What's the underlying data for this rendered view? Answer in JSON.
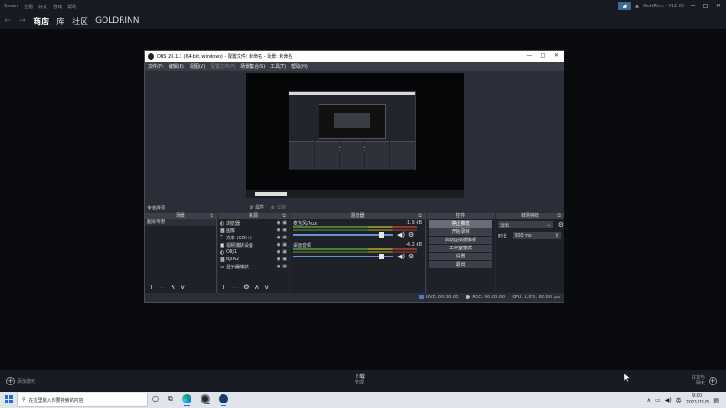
{
  "steam": {
    "menu": [
      "Steam",
      "查看",
      "好友",
      "游戏",
      "帮助"
    ],
    "nav": {
      "back": "←",
      "forward": "→",
      "store": "商店",
      "library": "库",
      "community": "社区",
      "username": "GOLDRINN"
    },
    "account": "GoldRinn · ¥12.00",
    "window_controls": {
      "minimize": "—",
      "maximize": "□",
      "close": "✕"
    },
    "bottom": {
      "add_game": "添加游戏",
      "downloads": "下载",
      "downloads_sub": "管理",
      "friends": "好友与",
      "chat": "聊天"
    }
  },
  "obs": {
    "title": "OBS 26.1.1 (64-bit, windows) - 配置文件: 未命名 - 场景: 未命名",
    "menu": [
      "文件(F)",
      "编辑(E)",
      "视图(V)",
      "配置文件(P)",
      "场景集合(S)",
      "工具(T)",
      "帮助(H)"
    ],
    "menu_disabled_index": 3,
    "no_source": "未选择源",
    "properties": "属性",
    "filters": "滤镜",
    "docks": {
      "scenes": "场景",
      "sources": "来源",
      "mixer": "混音器",
      "controls": "控件",
      "transitions": "转场特效"
    },
    "scenes": [
      "超清专用"
    ],
    "sources": [
      {
        "icon": "◐",
        "label": "浏览器"
      },
      {
        "icon": "▦",
        "label": "图像"
      },
      {
        "icon": "T",
        "label": "文本 (GDI+)"
      },
      {
        "icon": "▣",
        "label": "视频捕获设备"
      },
      {
        "icon": "◐",
        "label": "OBJ1"
      },
      {
        "icon": "▦",
        "label": "BJTA2"
      },
      {
        "icon": "▭",
        "label": "显示器捕获"
      }
    ],
    "mixer": [
      {
        "name": "麦克风/Aux",
        "db": "-1.9 dB"
      },
      {
        "name": "桌面音频",
        "db": "-4.2 dB"
      }
    ],
    "controls": [
      "停止推流",
      "开始录制",
      "启动虚拟摄像机",
      "工作室模式",
      "设置",
      "退出"
    ],
    "controls_active_index": 0,
    "transition": {
      "type": "淡出",
      "duration_label": "时长",
      "duration": "300 ms"
    },
    "status": {
      "live": "LIVE: 00:00:00",
      "rec": "REC: 00:00:00",
      "cpu": "CPU: 1.0%, 60.00 fps"
    },
    "dock_footer_buttons": [
      "+",
      "—",
      "∧",
      "∨"
    ],
    "source_footer_buttons": [
      "+",
      "—",
      "⚙",
      "∧",
      "∨"
    ]
  },
  "taskbar": {
    "search_placeholder": "在这里输入你要搜索的内容",
    "time": "9:03",
    "date": "2021/11/5",
    "lang": "英"
  },
  "colors": {
    "obs_bg": "#272a33",
    "steam_bg": "#171a21",
    "accent": "#3d6c8d"
  }
}
